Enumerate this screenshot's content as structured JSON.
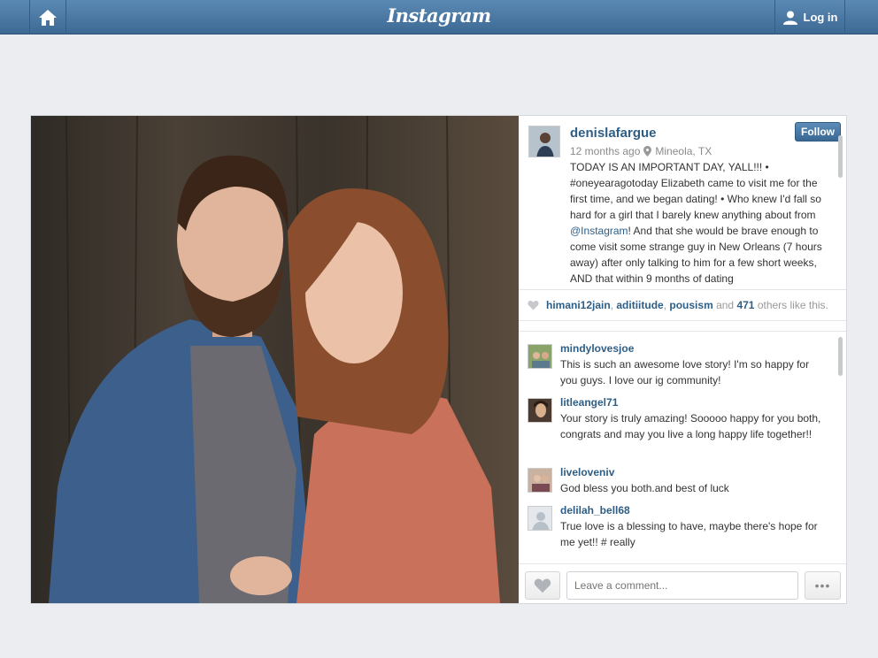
{
  "app": {
    "logo": "Instagram",
    "login_label": "Log in"
  },
  "post": {
    "username": "denislafargue",
    "follow_label": "Follow",
    "time_ago": "12 months ago",
    "location": "Mineola, TX",
    "caption": {
      "part1": "TODAY IS AN IMPORTANT DAY, YALL!!! • #oneyearagotoday Elizabeth came to visit me for the first time, and we began dating! • Who knew I'd fall so hard for a girl that I barely knew anything about from ",
      "mention": "@Instagram",
      "part2": "! And that she would be brave enough to come visit some strange guy in New Orleans (7 hours away) after only talking to him for a few short weeks, AND that within 9 months of dating"
    },
    "likes": {
      "user1": "himani12jain",
      "user2": "aditiitude",
      "user3": "pousism",
      "and": "and",
      "count": "471",
      "suffix": "others like this."
    }
  },
  "comments": [
    {
      "user": "mindylovesjoe",
      "text": "This is such an awesome love story! I'm so happy for you guys.      I love our ig community!"
    },
    {
      "user": "litleangel71",
      "text": "Your story is truly amazing! Sooooo happy for you both, congrats and may you live a long happy life together!!"
    },
    {
      "user": "liveloveniv",
      "text": "God bless you both.and best of luck"
    },
    {
      "user": "delilah_bell68",
      "text": "True love is a blessing to have, maybe there's hope for me yet!! # really"
    }
  ],
  "composer": {
    "placeholder": "Leave a comment...",
    "more_label": "•••"
  },
  "colors": {
    "topbar": "#4a7aa6",
    "link": "#2e5e86"
  }
}
